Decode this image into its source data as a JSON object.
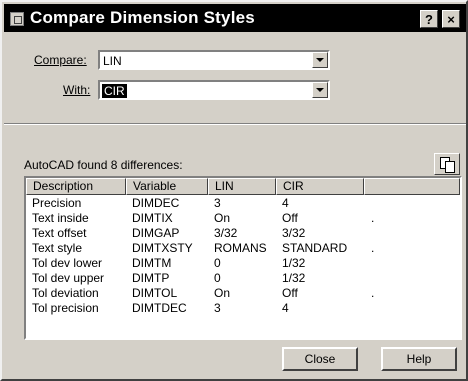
{
  "window": {
    "title": "Compare Dimension Styles",
    "help_btn": "?",
    "close_btn": "×"
  },
  "compare": {
    "label": "Compare:",
    "value": "LIN"
  },
  "with": {
    "label": "With:",
    "value": "CIR"
  },
  "found_text": "AutoCAD found 8 differences:",
  "table": {
    "columns": [
      "Description",
      "Variable",
      "LIN",
      "CIR"
    ],
    "rows": [
      [
        "Precision",
        "DIMDEC",
        "3",
        "4",
        ""
      ],
      [
        "Text inside",
        "DIMTIX",
        "On",
        "Off",
        "."
      ],
      [
        "Text offset",
        "DIMGAP",
        "3/32",
        "3/32",
        ""
      ],
      [
        "Text style",
        "DIMTXSTY",
        "ROMANS",
        "STANDARD",
        "."
      ],
      [
        "Tol dev lower",
        "DIMTM",
        "0",
        "1/32",
        ""
      ],
      [
        "Tol dev upper",
        "DIMTP",
        "0",
        "1/32",
        ""
      ],
      [
        "Tol deviation",
        "DIMTOL",
        "On",
        "Off",
        "."
      ],
      [
        "Tol precision",
        "DIMTDEC",
        "3",
        "4",
        ""
      ]
    ]
  },
  "buttons": {
    "close": "Close",
    "help": "Help"
  },
  "icons": {
    "copy": "copy-to-clipboard-icon",
    "app": "autocad-app-icon"
  }
}
